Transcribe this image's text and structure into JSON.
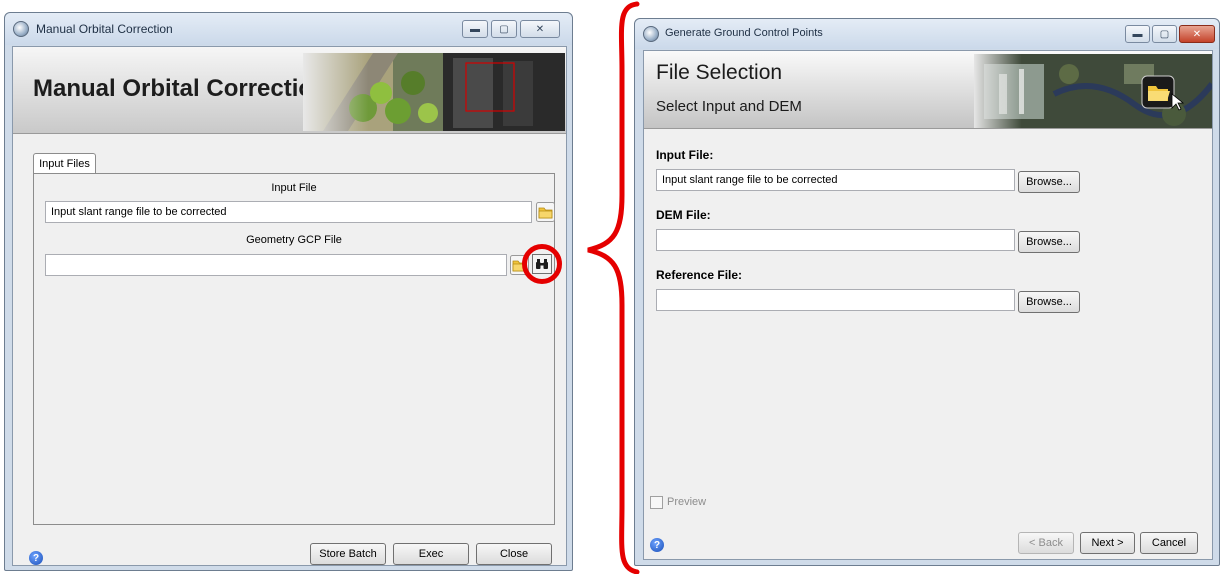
{
  "left_window": {
    "title": "Manual Orbital Correction",
    "banner_title": "Manual Orbital Correction",
    "tab_label": "Input Files",
    "input_file_label": "Input File",
    "input_file_value": "Input slant range file to be corrected",
    "geometry_label": "Geometry GCP File",
    "geometry_value": "",
    "buttons": {
      "store_batch": "Store Batch",
      "exec": "Exec",
      "close": "Close"
    }
  },
  "right_window": {
    "title": "Generate Ground Control Points",
    "banner_title": "File Selection",
    "banner_subtitle": "Select Input and DEM",
    "input_file_label": "Input File:",
    "input_file_value": "Input slant range file to be corrected",
    "dem_file_label": "DEM File:",
    "dem_file_value": "",
    "reference_file_label": "Reference File:",
    "reference_file_value": "",
    "browse_label": "Browse...",
    "preview_label": "Preview",
    "buttons": {
      "back": "< Back",
      "next": "Next >",
      "cancel": "Cancel"
    }
  },
  "icons": [
    "app-icon",
    "minimize-icon",
    "maximize-icon",
    "close-icon",
    "folder-open-icon",
    "binoculars-icon",
    "help-icon"
  ],
  "colors": {
    "highlight": "#e50000",
    "titlebar": "#cbd9ea",
    "client_bg": "#f0f0f0"
  }
}
